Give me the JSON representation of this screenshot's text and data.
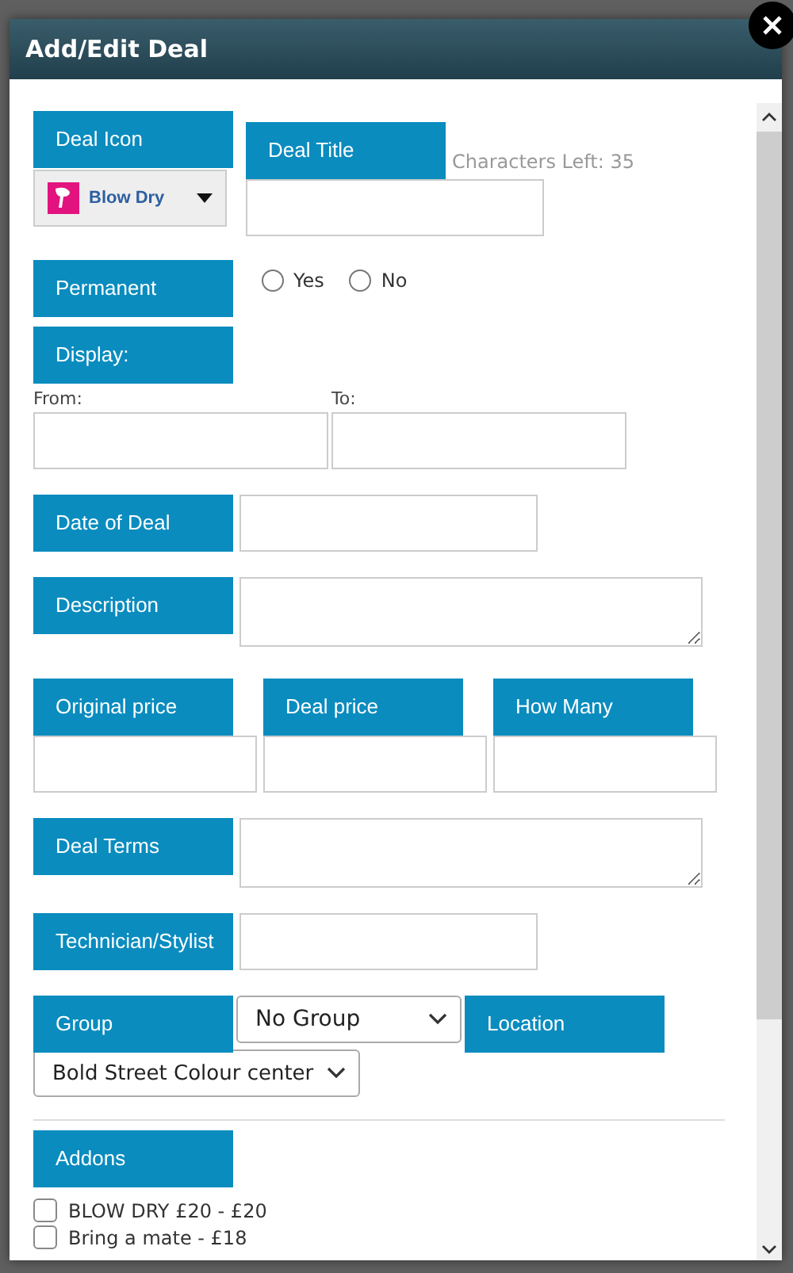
{
  "dialog": {
    "title": "Add/Edit Deal"
  },
  "deal_icon": {
    "label": "Deal Icon",
    "value": "Blow Dry"
  },
  "deal_title": {
    "label": "Deal Title",
    "counter": "Characters Left: 35"
  },
  "permanent": {
    "label": "Permanent",
    "options": [
      {
        "label": "Yes",
        "selected": false
      },
      {
        "label": "No",
        "selected": false
      }
    ]
  },
  "display": {
    "label": "Display:",
    "from_label": "From:",
    "to_label": "To:"
  },
  "date_of_deal": {
    "label": "Date of Deal"
  },
  "description": {
    "label": "Description"
  },
  "prices": [
    {
      "label": "Original price"
    },
    {
      "label": "Deal price"
    },
    {
      "label": "How Many"
    }
  ],
  "deal_terms": {
    "label": "Deal Terms"
  },
  "technician": {
    "label": "Technician/Stylist"
  },
  "group": {
    "label": "Group",
    "value": "No Group"
  },
  "location": {
    "label": "Location",
    "value": "Bold Street Colour center"
  },
  "addons": {
    "label": "Addons",
    "items": [
      {
        "label": "BLOW DRY £20 - £20",
        "checked": false
      },
      {
        "label": "Bring a mate - £18",
        "checked": false
      }
    ]
  }
}
